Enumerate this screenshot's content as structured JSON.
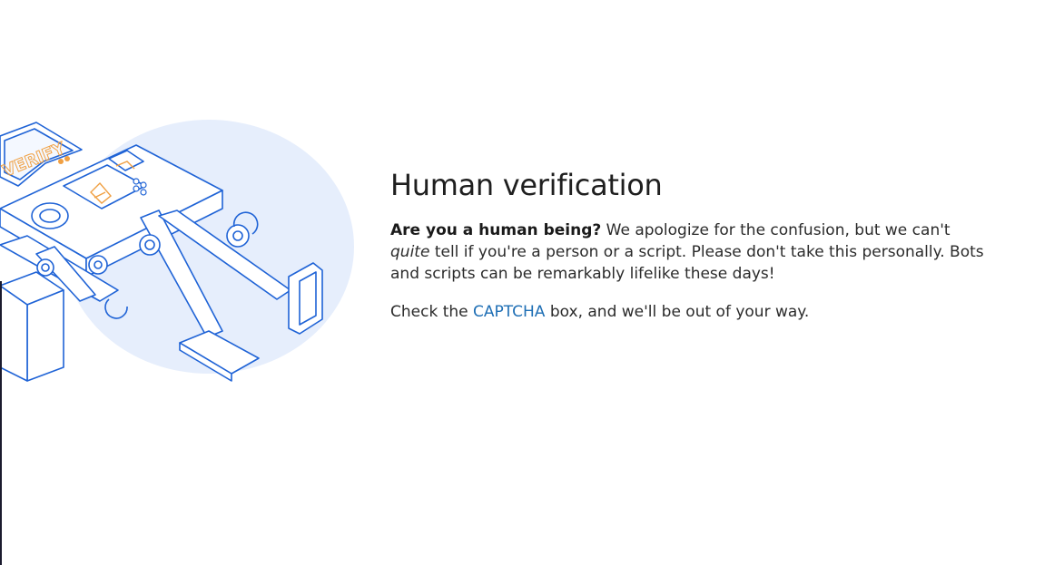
{
  "heading": "Human verification",
  "intro": {
    "question": "Are you a human being?",
    "text_before_emphasis": " We apologize for the confusion, but we can't ",
    "emphasis": "quite",
    "text_after_emphasis": " tell if you're a person or a script. Please don't take this personally. Bots and scripts can be remarkably lifelike these days!"
  },
  "instruction": {
    "before_link": "Check the ",
    "link_text": "CAPTCHA",
    "after_link": " box, and we'll be out of your way."
  },
  "illustration": {
    "robot_screen_text": "VERIFY",
    "accent_color": "#1f63d6",
    "backdrop_color": "#e6eefc"
  },
  "colors": {
    "link": "#1f6fb5",
    "text": "#2b2b2b"
  }
}
